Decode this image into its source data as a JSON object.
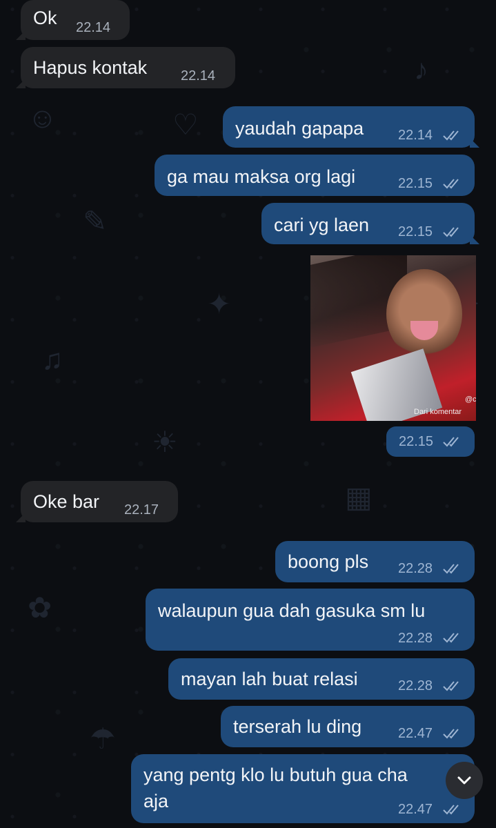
{
  "chat": {
    "messages": [
      {
        "direction": "incoming",
        "text": "Ok",
        "time": "22.14"
      },
      {
        "direction": "incoming",
        "text": "Hapus kontak",
        "time": "22.14"
      },
      {
        "direction": "outgoing",
        "text": "yaudah gapapa",
        "time": "22.14",
        "status": "read"
      },
      {
        "direction": "outgoing",
        "text": "ga mau maksa org lagi",
        "time": "22.15",
        "status": "read"
      },
      {
        "direction": "outgoing",
        "text": "cari yg laen",
        "time": "22.15",
        "status": "read"
      },
      {
        "direction": "outgoing",
        "type": "image",
        "caption_overlay": "Dari komentar",
        "handle_overlay": "@c",
        "time": "22.15",
        "status": "read"
      },
      {
        "direction": "incoming",
        "text": "Oke bar",
        "time": "22.17"
      },
      {
        "direction": "outgoing",
        "text": "boong pls",
        "time": "22.28",
        "status": "read"
      },
      {
        "direction": "outgoing",
        "text": "walaupun gua dah gasuka sm lu",
        "time": "22.28",
        "status": "read"
      },
      {
        "direction": "outgoing",
        "text": "mayan lah buat relasi",
        "time": "22.28",
        "status": "read"
      },
      {
        "direction": "outgoing",
        "text": "terserah lu ding",
        "time": "22.47",
        "status": "read"
      },
      {
        "direction": "outgoing",
        "text": "yang pentg klo lu butuh gua cha",
        "text_line2": "aja",
        "time": "22.47",
        "status": "read"
      }
    ]
  },
  "icons": {
    "read_ticks": "double-check-icon",
    "scroll_down": "chevron-down-icon"
  },
  "colors": {
    "background": "#0c0e12",
    "incoming_bubble": "#232427",
    "outgoing_bubble": "#1f4a7a",
    "text": "#f2f4f7"
  }
}
